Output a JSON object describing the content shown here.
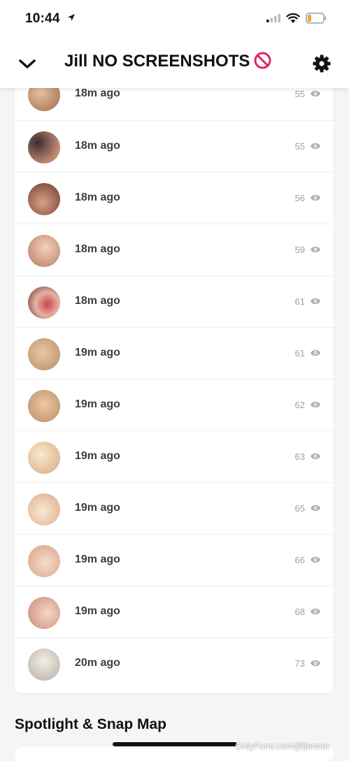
{
  "status_bar": {
    "time": "10:44"
  },
  "header": {
    "title": "Jill NO SCREENSHOTS"
  },
  "stories": [
    {
      "time": "18m ago",
      "views": "55"
    },
    {
      "time": "18m ago",
      "views": "55"
    },
    {
      "time": "18m ago",
      "views": "56"
    },
    {
      "time": "18m ago",
      "views": "59"
    },
    {
      "time": "18m ago",
      "views": "61"
    },
    {
      "time": "19m ago",
      "views": "61"
    },
    {
      "time": "19m ago",
      "views": "62"
    },
    {
      "time": "19m ago",
      "views": "63"
    },
    {
      "time": "19m ago",
      "views": "65"
    },
    {
      "time": "19m ago",
      "views": "66"
    },
    {
      "time": "19m ago",
      "views": "68"
    },
    {
      "time": "20m ago",
      "views": "73"
    }
  ],
  "section": {
    "title": "Spotlight & Snap Map"
  },
  "watermark": "OnlyFans.com/jilljenner",
  "colors": {
    "no_symbol": "#e0245e",
    "battery_low": "#f0a23c"
  }
}
